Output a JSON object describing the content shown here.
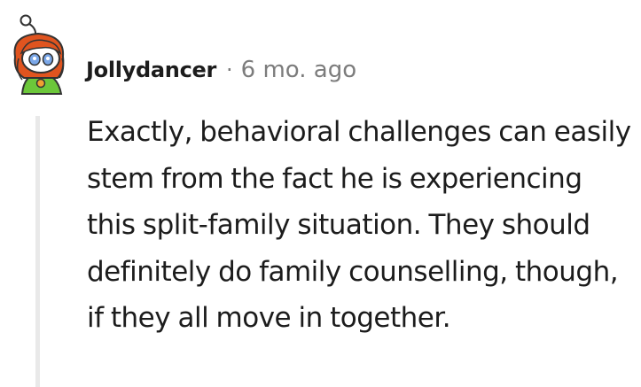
{
  "comment": {
    "author": "Jollydancer",
    "separator": "·",
    "timestamp": "6 mo. ago",
    "body": "Exactly, behavioral challenges can easily stem from the fact he is experiencing this split-family situation. They should definitely do family counselling, though, if they all move in together.",
    "avatar_icon": "snoo-avatar-icon"
  },
  "colors": {
    "text": "#1c1c1c",
    "meta": "#7c7c7c",
    "thread_line": "#e9e9e9",
    "avatar_hair": "#e0541f",
    "avatar_shirt": "#6cc73a"
  }
}
